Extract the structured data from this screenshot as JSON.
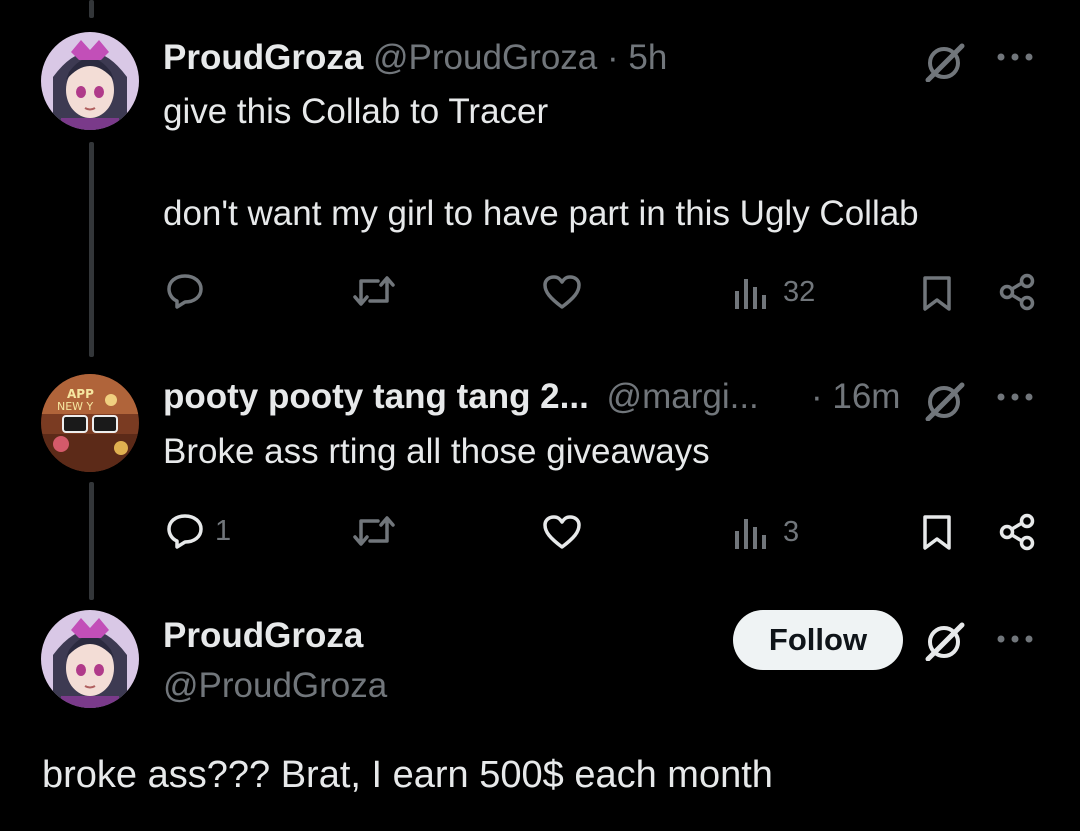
{
  "tweets": [
    {
      "display_name": "ProudGroza",
      "handle": "@ProudGroza",
      "time": "· 5h",
      "lines": [
        "give this Collab to Tracer",
        "don't want my girl to have part in this Ugly Collab"
      ],
      "reply_count": "",
      "views": "32"
    },
    {
      "display_name": "pooty pooty tang tang 2...",
      "handle": "@margi...",
      "time": "· 16m",
      "lines": [
        "Broke ass rting all those giveaways"
      ],
      "reply_count": "1",
      "views": "3"
    }
  ],
  "main_tweet": {
    "display_name": "ProudGroza",
    "handle": "@ProudGroza",
    "follow_label": "Follow",
    "text": "broke ass??? Brat, I earn 500$ each month"
  },
  "icons": {
    "reply": "reply-icon",
    "retweet": "retweet-icon",
    "like": "like-icon",
    "views": "views-icon",
    "bookmark": "bookmark-icon",
    "share": "share-icon",
    "grok": "grok-icon",
    "more": "more-icon"
  },
  "colors": {
    "background": "#000000",
    "text": "#e7e9ea",
    "muted": "#71767b",
    "follow_bg": "#eff3f4"
  }
}
